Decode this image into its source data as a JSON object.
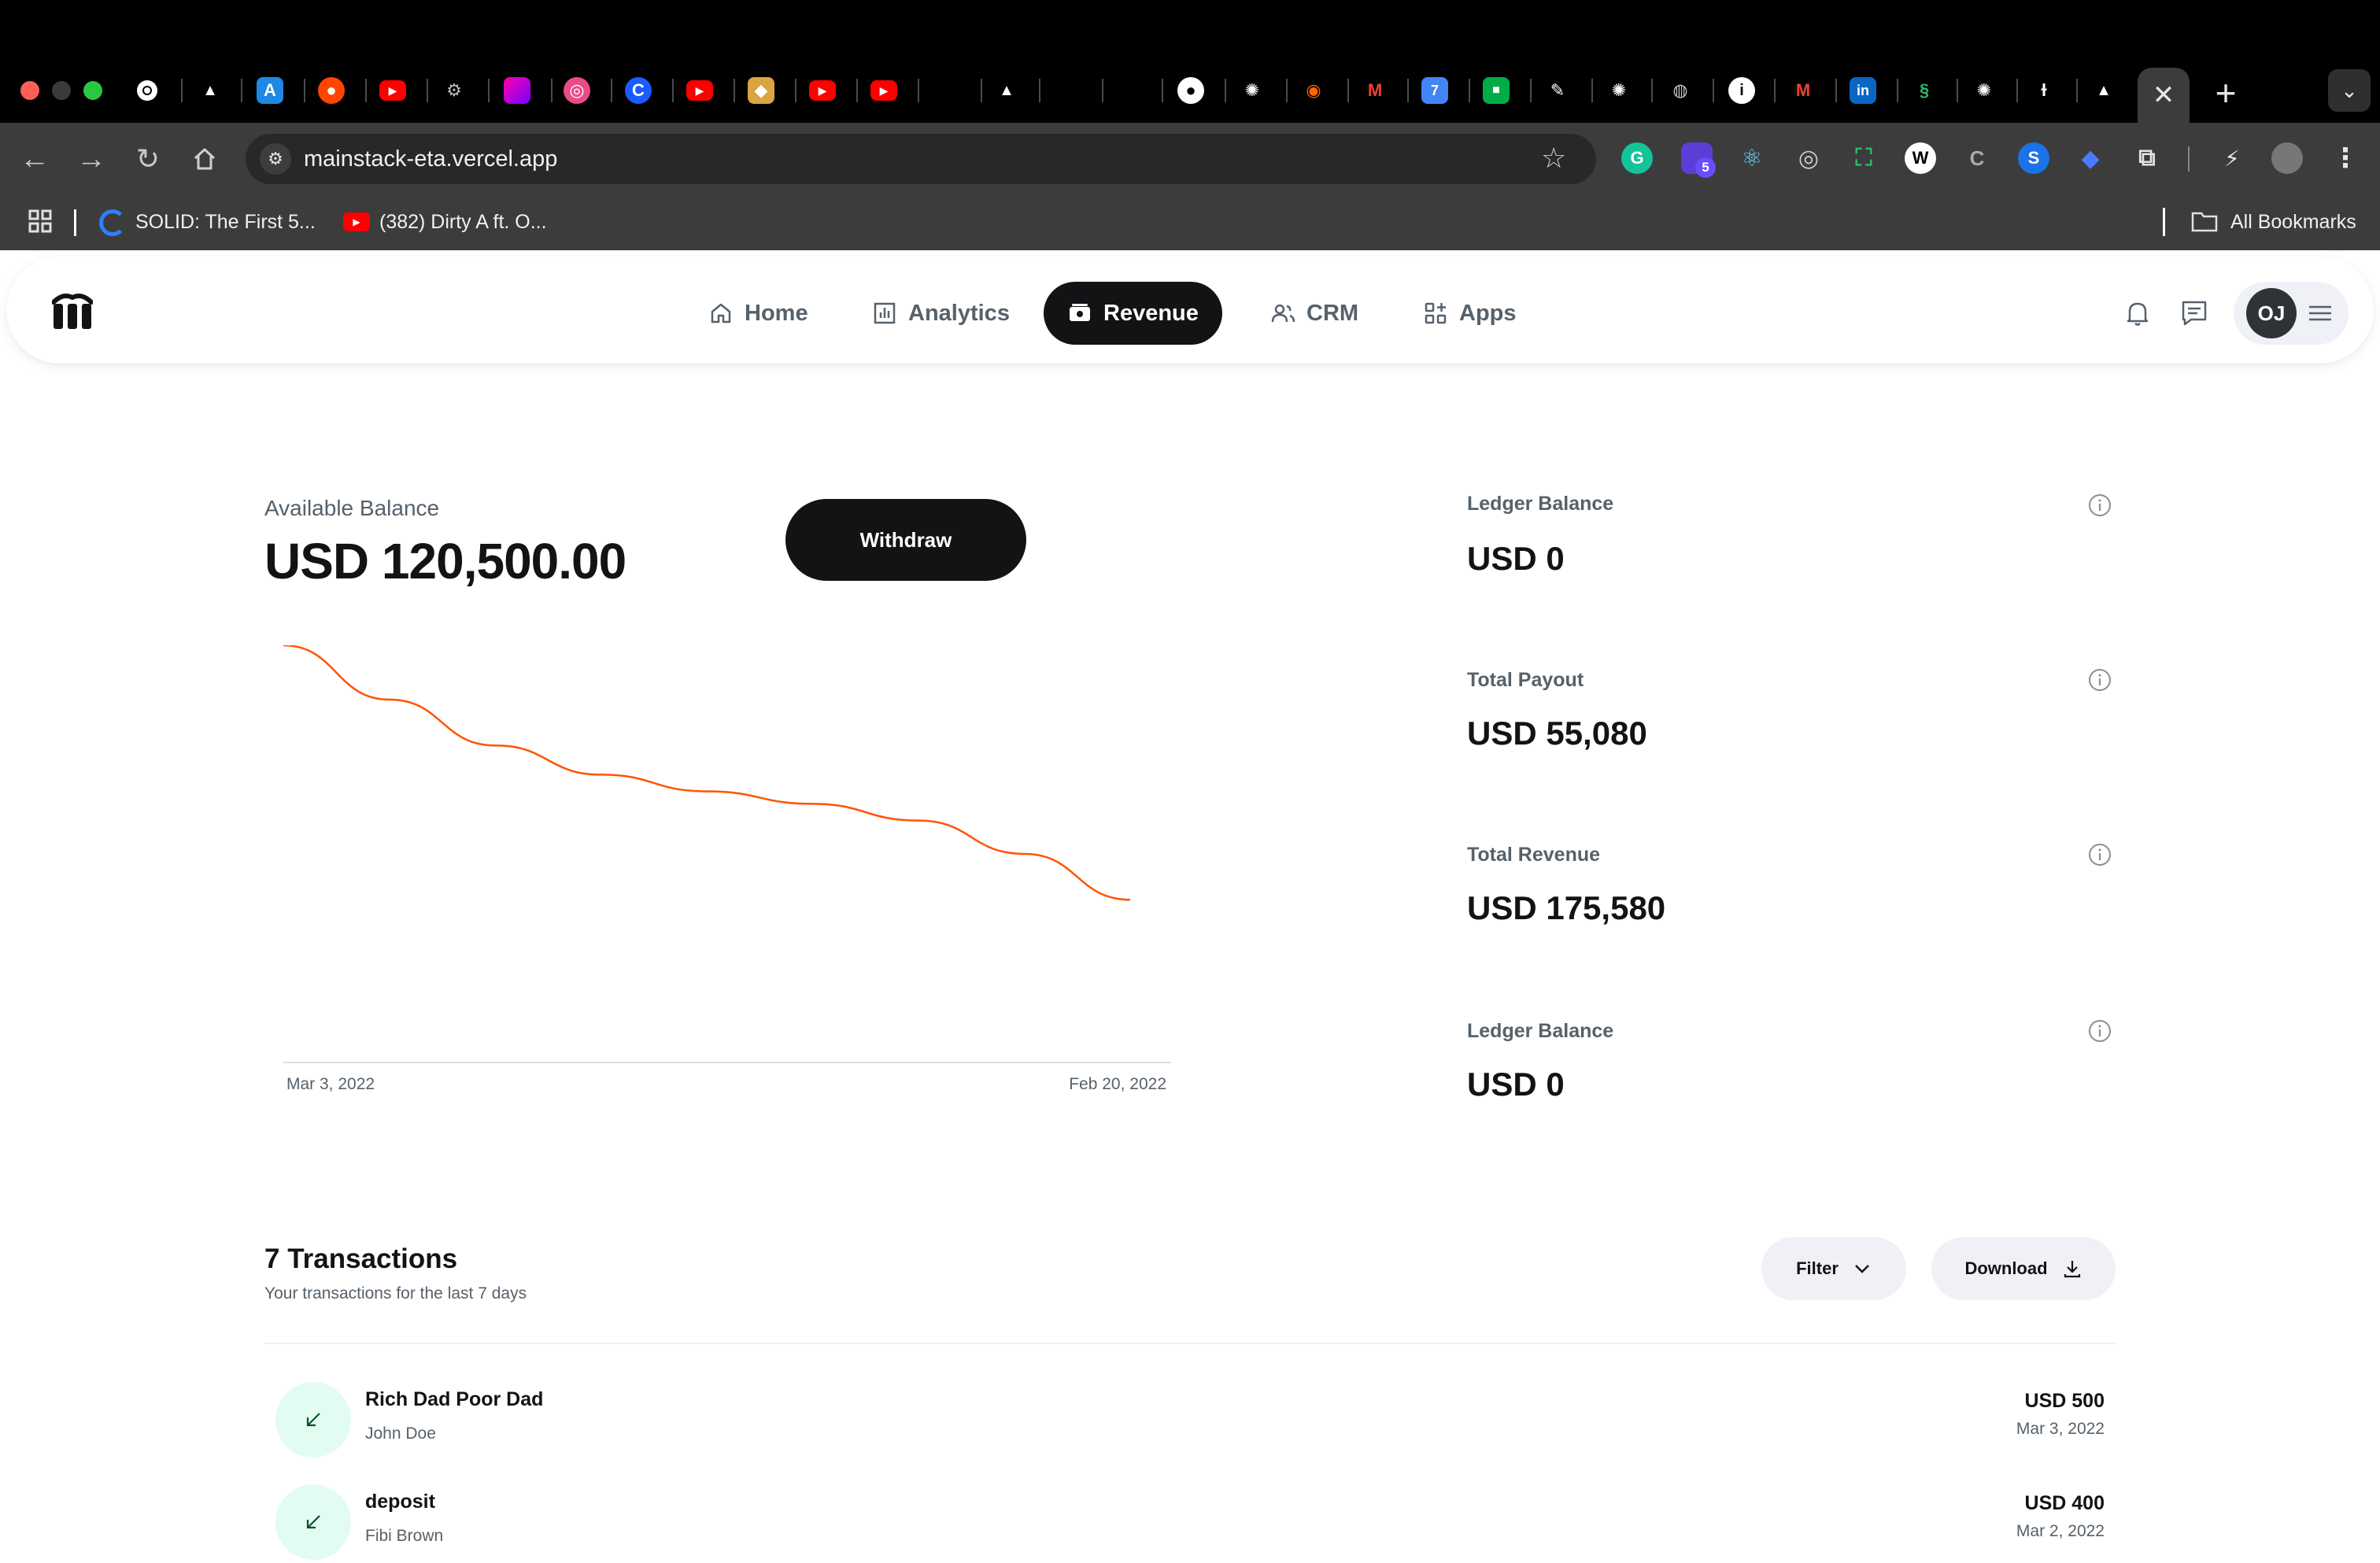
{
  "browser": {
    "url": "mainstack-eta.vercel.app",
    "extension_badge": "5",
    "bookmarks": [
      {
        "label": "SOLID: The First 5..."
      },
      {
        "label": "(382) Dirty A ft. O..."
      }
    ],
    "all_bookmarks_label": "All Bookmarks"
  },
  "app": {
    "nav": [
      {
        "label": "Home",
        "icon": "home-icon"
      },
      {
        "label": "Analytics",
        "icon": "analytics-icon"
      },
      {
        "label": "Revenue",
        "icon": "revenue-icon",
        "active": true
      },
      {
        "label": "CRM",
        "icon": "users-icon"
      },
      {
        "label": "Apps",
        "icon": "apps-icon"
      }
    ],
    "avatar_initials": "OJ",
    "available_balance_label": "Available Balance",
    "available_balance_value": "USD 120,500.00",
    "withdraw_label": "Withdraw",
    "stats": [
      {
        "label": "Ledger Balance",
        "value": "USD 0"
      },
      {
        "label": "Total Payout",
        "value": "USD 55,080"
      },
      {
        "label": "Total Revenue",
        "value": "USD 175,580"
      },
      {
        "label": "Ledger Balance",
        "value": "USD 0"
      }
    ],
    "transactions": {
      "title": "7 Transactions",
      "subtitle": "Your transactions for the last 7 days",
      "filter_label": "Filter",
      "download_label": "Download",
      "items": [
        {
          "name": "Rich Dad Poor Dad",
          "person": "John Doe",
          "amount": "USD 500",
          "date": "Mar 3, 2022"
        },
        {
          "name": "deposit",
          "person": "Fibi Brown",
          "amount": "USD 400",
          "date": "Mar 2, 2022"
        }
      ]
    }
  },
  "chart_data": {
    "type": "line",
    "x_labels": [
      "Mar 3, 2022",
      "Feb 20, 2022"
    ],
    "series": [
      {
        "color": "#ff5403",
        "values": [
          100,
          87,
          76,
          69,
          65,
          62,
          58,
          50,
          39
        ]
      }
    ],
    "color": "#ff5403",
    "grid": false
  }
}
